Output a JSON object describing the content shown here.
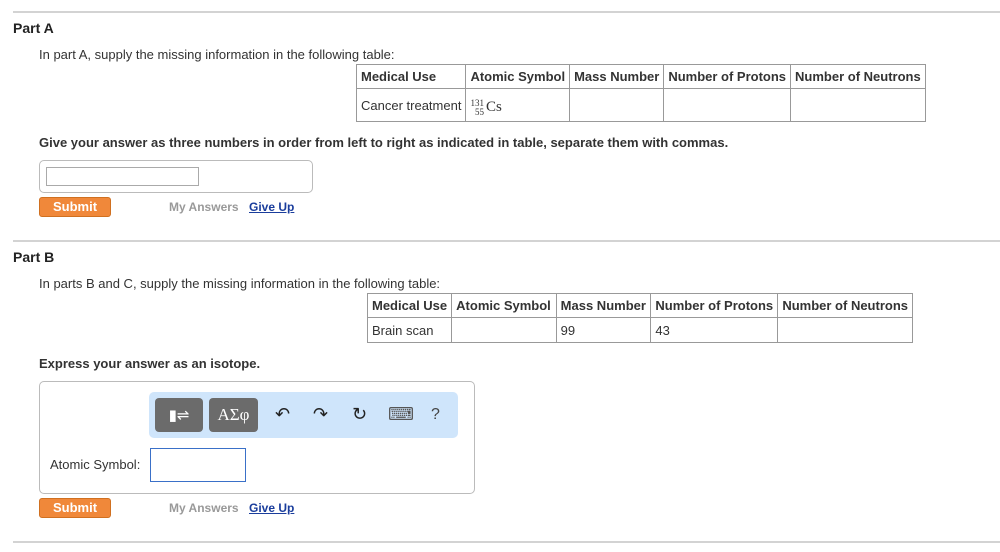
{
  "partA": {
    "title": "Part A",
    "instruction": "In part A, supply the missing information in the following table:",
    "table": {
      "headers": [
        "Medical Use",
        "Atomic Symbol",
        "Mass Number",
        "Number of Protons",
        "Number of Neutrons"
      ],
      "row": {
        "use": "Cancer treatment",
        "symbol": {
          "mass": "131",
          "atomic": "55",
          "element": "Cs"
        },
        "mass": "",
        "protons": "",
        "neutrons": ""
      }
    },
    "prompt": "Give your answer as three numbers in order from left to right as indicated in table, separate them with commas.",
    "answer_value": "",
    "submit": "Submit",
    "my_answers": "My Answers",
    "give_up": "Give Up"
  },
  "partB": {
    "title": "Part B",
    "instruction": "In parts B and C, supply the missing information in the following table:",
    "table": {
      "headers": [
        "Medical Use",
        "Atomic Symbol",
        "Mass Number",
        "Number of Protons",
        "Number of Neutrons"
      ],
      "row": [
        "Brain scan",
        "",
        "99",
        "43",
        ""
      ]
    },
    "prompt": "Express your answer as an isotope.",
    "toolbar": {
      "template": "▮⇌",
      "greek": "ΑΣφ",
      "undo": "↶",
      "redo": "↷",
      "reset": "↻",
      "keyboard": "⌨",
      "help": "?"
    },
    "atomic_symbol_label": "Atomic Symbol:",
    "atomic_symbol_value": "",
    "submit": "Submit",
    "my_answers": "My Answers",
    "give_up": "Give Up"
  }
}
